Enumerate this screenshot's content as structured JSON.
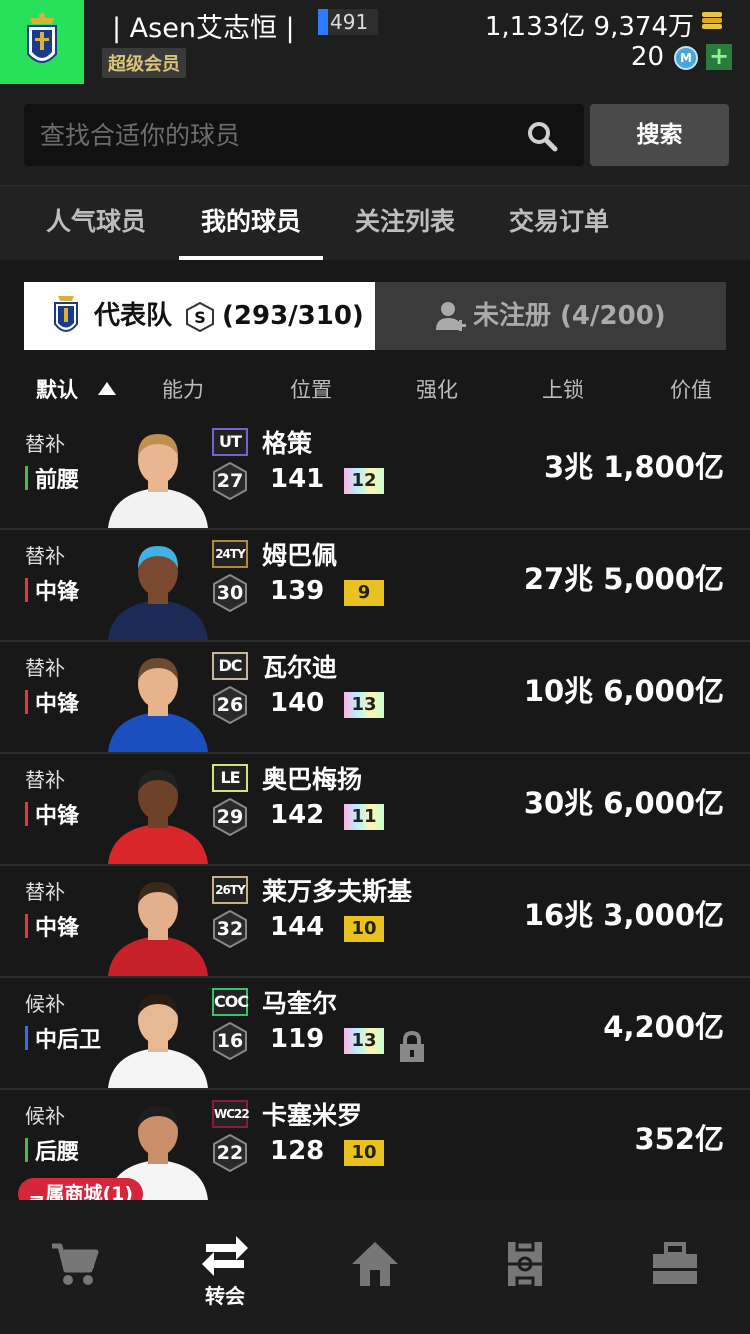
{
  "header": {
    "username": "| Asen艾志恒 |",
    "level": "491",
    "member_badge": "超级会员",
    "coins": "1,133亿 9,374万",
    "mcoins": "20",
    "mcoin_label": "M",
    "add_label": "+"
  },
  "search": {
    "placeholder": "查找合适你的球员",
    "button_label": "搜索"
  },
  "tabs": [
    {
      "label": "人气球员",
      "active": false
    },
    {
      "label": "我的球员",
      "active": true
    },
    {
      "label": "关注列表",
      "active": false
    },
    {
      "label": "交易订单",
      "active": false
    }
  ],
  "squad_toggle": {
    "active_label": "代表队",
    "active_grade": "S",
    "active_count": "(293/310)",
    "inactive_label": "未注册 (4/200)"
  },
  "sort_columns": [
    "默认",
    "能力",
    "位置",
    "强化",
    "上锁",
    "价值"
  ],
  "players": [
    {
      "role": "替补",
      "position": "前腰",
      "pos_color": "#3fbf4a",
      "season": "UT",
      "season_color": "#7a5fd6",
      "ovr": "27",
      "name": "格策",
      "rating": "141",
      "enhance": "12",
      "enhance_style": "rainbow",
      "locked": false,
      "value": "3兆 1,800亿",
      "jersey": "#f2f2f2",
      "skin": "#e8b792",
      "hair": "#c09050"
    },
    {
      "role": "替补",
      "position": "中锋",
      "pos_color": "#e23b3b",
      "season": "24TY",
      "season_color": "#b08a3c",
      "ovr": "30",
      "name": "姆巴佩",
      "rating": "139",
      "enhance": "9",
      "enhance_style": "gold",
      "locked": false,
      "value": "27兆 5,000亿",
      "jersey": "#1c2a55",
      "skin": "#7a4a30",
      "hair": "#3fb2e8"
    },
    {
      "role": "替补",
      "position": "中锋",
      "pos_color": "#e23b3b",
      "season": "DC",
      "season_color": "#c9b79a",
      "ovr": "26",
      "name": "瓦尔迪",
      "rating": "140",
      "enhance": "13",
      "enhance_style": "rainbow",
      "locked": false,
      "value": "10兆 6,000亿",
      "jersey": "#1b4fbf",
      "skin": "#e6b38c",
      "hair": "#6b4a2e"
    },
    {
      "role": "替补",
      "position": "中锋",
      "pos_color": "#e23b3b",
      "season": "LE",
      "season_color": "#d7e27a",
      "ovr": "29",
      "name": "奥巴梅扬",
      "rating": "142",
      "enhance": "11",
      "enhance_style": "rainbow",
      "locked": false,
      "value": "30兆 6,000亿",
      "jersey": "#d8262b",
      "skin": "#6e4228",
      "hair": "#222222"
    },
    {
      "role": "替补",
      "position": "中锋",
      "pos_color": "#e23b3b",
      "season": "26TY",
      "season_color": "#c9b08a",
      "ovr": "32",
      "name": "莱万多夫斯基",
      "rating": "144",
      "enhance": "10",
      "enhance_style": "gold",
      "locked": false,
      "value": "16兆 3,000亿",
      "jersey": "#c7202a",
      "skin": "#e2b08a",
      "hair": "#3a2a1c"
    },
    {
      "role": "候补",
      "position": "中后卫",
      "pos_color": "#3a6cf0",
      "season": "COC",
      "season_color": "#31c46a",
      "ovr": "16",
      "name": "马奎尔",
      "rating": "119",
      "enhance": "13",
      "enhance_style": "rainbow",
      "locked": true,
      "value": "4,200亿",
      "jersey": "#f5f5f5",
      "skin": "#e6b894",
      "hair": "#2a1c12"
    },
    {
      "role": "候补",
      "position": "后腰",
      "pos_color": "#3fbf4a",
      "season": "WC22",
      "season_color": "#8a1a3a",
      "ovr": "22",
      "name": "卡塞米罗",
      "rating": "128",
      "enhance": "10",
      "enhance_style": "gold",
      "locked": false,
      "value": "352亿",
      "jersey": "#f5f5f5",
      "skin": "#c98f6a",
      "hair": "#1e1e1e"
    }
  ],
  "shop_badge": "ᆿ属商城(1)",
  "bottom_nav": [
    {
      "icon": "cart-icon",
      "label": ""
    },
    {
      "icon": "transfer-icon",
      "label": "转会"
    },
    {
      "icon": "home-icon",
      "label": ""
    },
    {
      "icon": "pitch-icon",
      "label": ""
    },
    {
      "icon": "briefcase-icon",
      "label": ""
    }
  ]
}
